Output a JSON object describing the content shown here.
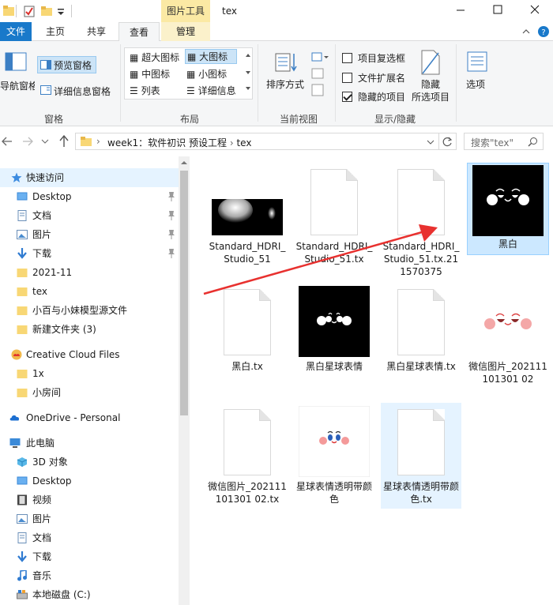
{
  "window": {
    "title": "tex",
    "contextual_tab": "图片工具"
  },
  "tabs": [
    "文件",
    "主页",
    "共享",
    "查看",
    "管理"
  ],
  "ribbon": {
    "panes_group": {
      "label": "窗格",
      "nav_pane": "导航窗格",
      "preview_pane": "预览窗格",
      "details_pane": "详细信息窗格"
    },
    "layout_group": {
      "label": "布局",
      "items": [
        "超大图标",
        "大图标",
        "中图标",
        "小图标",
        "列表",
        "详细信息"
      ],
      "selected": "大图标"
    },
    "current_view_group": {
      "label": "当前视图",
      "sort_by": "排序方式"
    },
    "show_hide_group": {
      "label": "显示/隐藏",
      "item_checkboxes": "项目复选框",
      "file_extensions": "文件扩展名",
      "hidden_items": "隐藏的项目",
      "hide_selected": "隐藏",
      "hide_selected_2": "所选项目",
      "item_checkboxes_checked": false,
      "file_extensions_checked": false,
      "hidden_items_checked": true
    },
    "options_label": "选项"
  },
  "address": {
    "path": "week1：软件初识 预设工程",
    "current": "tex",
    "search_placeholder": "搜索\"tex\""
  },
  "nav": {
    "quick_access": "快速访问",
    "quick_items": [
      "Desktop",
      "文档",
      "图片",
      "下载",
      "2021-11",
      "tex",
      "小百与小妹模型源文件",
      "新建文件夹 (3)"
    ],
    "creative_cloud": "Creative Cloud Files",
    "cc_items": [
      "1x",
      "小房间"
    ],
    "onedrive": "OneDrive - Personal",
    "this_pc": "此电脑",
    "pc_items": [
      "3D 对象",
      "Desktop",
      "视频",
      "图片",
      "文档",
      "下载",
      "音乐",
      "本地磁盘 (C:)"
    ]
  },
  "files": [
    "Standard_HDRI_Studio_51",
    "Standard_HDRI_Studio_51.tx",
    "Standard_HDRI_Studio_51.tx.21 1570375",
    "黑白",
    "黑白.tx",
    "黑白星球表情",
    "黑白星球表情.tx",
    "微信图片_202111101301 02",
    "微信图片_202111101301 02.tx",
    "星球表情透明带颜色",
    "星球表情透明带颜色.tx"
  ],
  "colors": {
    "accent": "#1979ca",
    "selection": "#cce8ff",
    "annotation_arrow": "#e8312f"
  }
}
